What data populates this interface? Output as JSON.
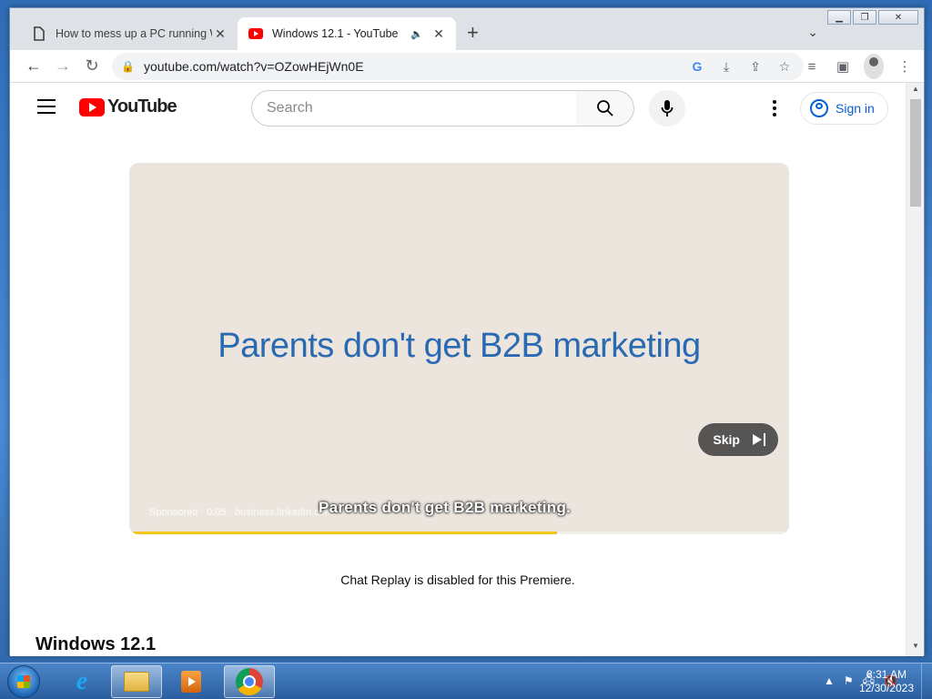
{
  "tabs": [
    {
      "title": "How to mess up a PC running Wi",
      "favicon": "blank-page-icon",
      "active": false
    },
    {
      "title": "Windows 12.1 - YouTube",
      "favicon": "youtube-icon",
      "active": true,
      "audio": true
    }
  ],
  "toolbar": {
    "url": "youtube.com/watch?v=OZowHEjWn0E"
  },
  "youtube": {
    "logo_text": "YouTube",
    "search_placeholder": "Search",
    "signin_label": "Sign in"
  },
  "player": {
    "ad_headline": "Parents don't get B2B marketing",
    "caption": "Parents don't get B2B marketing.",
    "ad_info": "Sponsored · 0:05 · business.linkedin.com",
    "skip_label": "Skip",
    "progress": 0.65
  },
  "page": {
    "chat_note": "Chat Replay is disabled for this Premiere.",
    "video_title": "Windows 12.1"
  },
  "taskbar": {
    "time": "8:31 AM",
    "date": "12/30/2023"
  },
  "colors": {
    "youtube_red": "#ff0000",
    "link_blue": "#065fd4",
    "ad_text_blue": "#2a6ab2",
    "progress_yellow": "#f5c518"
  }
}
